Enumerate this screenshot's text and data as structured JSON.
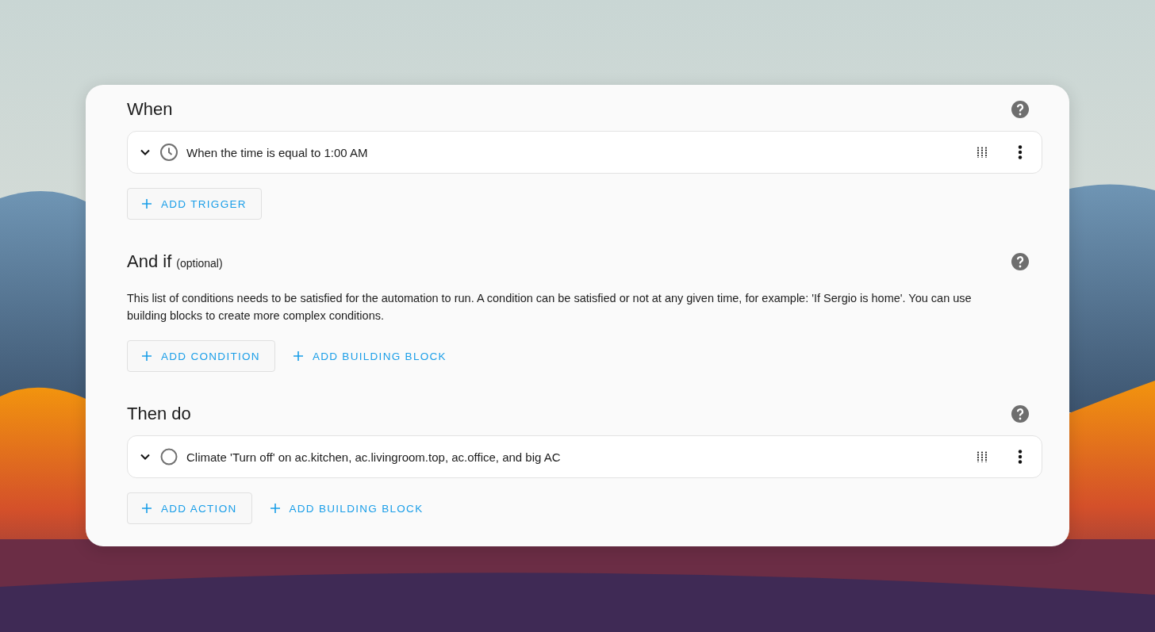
{
  "sections": [
    {
      "title": "When",
      "items": [
        {
          "kind": "clock",
          "text": "When the time is equal to 1:00 AM"
        }
      ],
      "buttons": [
        {
          "kind": "outlined",
          "label": "ADD TRIGGER"
        }
      ]
    },
    {
      "title": "And if",
      "subtitle": "(optional)",
      "description": "This list of conditions needs to be satisfied for the automation to run. A condition can be satisfied or not at any given time, for example: 'If Sergio is home'. You can use building blocks to create more complex conditions.",
      "buttons": [
        {
          "kind": "outlined",
          "label": "ADD CONDITION"
        },
        {
          "kind": "text",
          "label": "ADD BUILDING BLOCK"
        }
      ]
    },
    {
      "title": "Then do",
      "items": [
        {
          "kind": "circle",
          "text": "Climate 'Turn off' on ac.kitchen, ac.livingroom.top, ac.office, and big AC"
        }
      ],
      "buttons": [
        {
          "kind": "outlined",
          "label": "ADD ACTION"
        },
        {
          "kind": "text",
          "label": "ADD BUILDING BLOCK"
        }
      ]
    }
  ]
}
